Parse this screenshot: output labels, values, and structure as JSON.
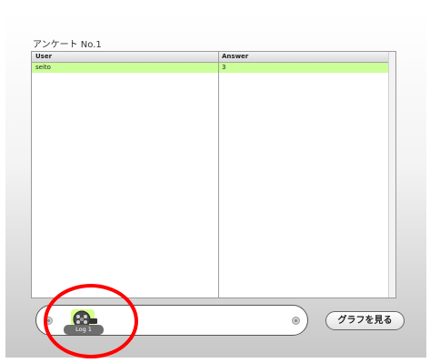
{
  "survey": {
    "title": "アンケート No.1"
  },
  "table": {
    "columns": [
      "User",
      "Answer"
    ],
    "rows": [
      {
        "user": "seito",
        "answer": "3"
      }
    ]
  },
  "bottom": {
    "log_label": "Log 1",
    "graph_button": "グラフを見る"
  },
  "colors": {
    "selected_row": "#ccff99",
    "annotation": "#ff0000"
  },
  "icons": {
    "log": "film-reel-icon",
    "scroll_left": "scroll-left-icon",
    "scroll_right": "scroll-right-icon"
  }
}
